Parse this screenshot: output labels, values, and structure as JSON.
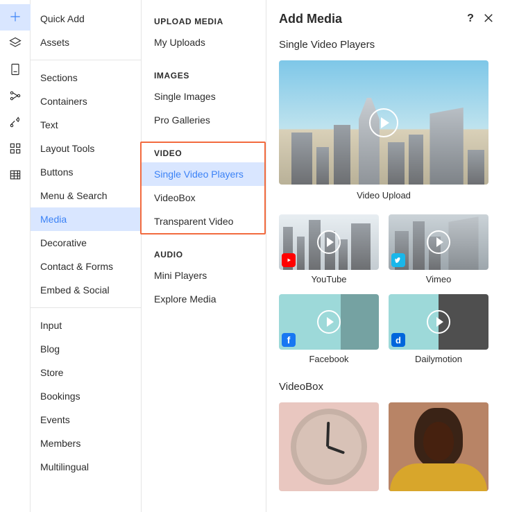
{
  "panel_title": "Add Media",
  "rail": [
    {
      "name": "add",
      "active": true
    },
    {
      "name": "layers",
      "active": false
    },
    {
      "name": "page",
      "active": false
    },
    {
      "name": "connect",
      "active": false
    },
    {
      "name": "font",
      "active": false
    },
    {
      "name": "apps",
      "active": false
    },
    {
      "name": "table",
      "active": false
    }
  ],
  "categories": [
    [
      {
        "label": "Quick Add",
        "active": false
      },
      {
        "label": "Assets",
        "active": false
      }
    ],
    [
      {
        "label": "Sections",
        "active": false
      },
      {
        "label": "Containers",
        "active": false
      },
      {
        "label": "Text",
        "active": false
      },
      {
        "label": "Layout Tools",
        "active": false
      },
      {
        "label": "Buttons",
        "active": false
      },
      {
        "label": "Menu & Search",
        "active": false
      },
      {
        "label": "Media",
        "active": true
      },
      {
        "label": "Decorative",
        "active": false
      },
      {
        "label": "Contact & Forms",
        "active": false
      },
      {
        "label": "Embed & Social",
        "active": false
      }
    ],
    [
      {
        "label": "Input",
        "active": false
      },
      {
        "label": "Blog",
        "active": false
      },
      {
        "label": "Store",
        "active": false
      },
      {
        "label": "Bookings",
        "active": false
      },
      {
        "label": "Events",
        "active": false
      },
      {
        "label": "Members",
        "active": false
      },
      {
        "label": "Multilingual",
        "active": false
      }
    ]
  ],
  "sub_groups": [
    {
      "heading": "UPLOAD MEDIA",
      "items": [
        {
          "label": "My Uploads",
          "active": false
        }
      ]
    },
    {
      "heading": "IMAGES",
      "items": [
        {
          "label": "Single Images",
          "active": false
        },
        {
          "label": "Pro Galleries",
          "active": false
        }
      ]
    },
    {
      "heading": "VIDEO",
      "highlighted": true,
      "items": [
        {
          "label": "Single Video Players",
          "active": true
        },
        {
          "label": "VideoBox",
          "active": false
        },
        {
          "label": "Transparent Video",
          "active": false
        }
      ]
    },
    {
      "heading": "AUDIO",
      "items": [
        {
          "label": "Mini Players",
          "active": false
        },
        {
          "label": "Explore Media",
          "active": false
        }
      ]
    }
  ],
  "section1": {
    "title": "Single Video Players",
    "big_label": "Video Upload",
    "providers": [
      {
        "label": "YouTube",
        "badge": "yt"
      },
      {
        "label": "Vimeo",
        "badge": "vm"
      },
      {
        "label": "Facebook",
        "badge": "fb"
      },
      {
        "label": "Dailymotion",
        "badge": "dm"
      }
    ]
  },
  "section2": {
    "title": "VideoBox"
  }
}
